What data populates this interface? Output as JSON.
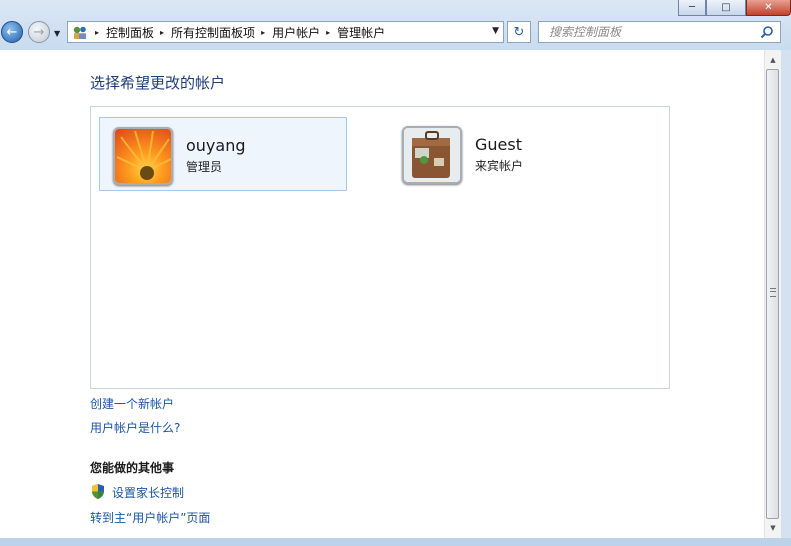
{
  "window": {
    "controls": {
      "minimize": "─",
      "maximize": "□",
      "close": "✕"
    }
  },
  "nav": {
    "back_icon": "←",
    "forward_icon": "→",
    "recent_icon": "▼"
  },
  "address_bar": {
    "icon": "control-panel-folder-icon",
    "breadcrumbs": [
      "控制面板",
      "所有控制面板项",
      "用户帐户",
      "管理帐户"
    ],
    "separator": "▸",
    "dropdown_icon": "▼"
  },
  "refresh_icon": "↻",
  "search": {
    "placeholder": "搜索控制面板"
  },
  "main": {
    "title": "选择希望更改的帐户",
    "accounts": [
      {
        "name": "ouyang",
        "type": "管理员",
        "picture": "orange-flower",
        "selected": true
      },
      {
        "name": "Guest",
        "type": "来宾帐户",
        "picture": "suitcase",
        "selected": false
      }
    ],
    "links": {
      "create_account": "创建一个新帐户",
      "what_is_account": "用户帐户是什么?"
    },
    "other_tasks": {
      "heading": "您能做的其他事",
      "parental_controls": "设置家长控制",
      "goto_main": "转到主“用户帐户”页面"
    }
  },
  "colors": {
    "link": "#1c55a6",
    "title": "#1e3e7a",
    "selected_bg": "#eef5fc",
    "selected_border": "#a9c9ea"
  }
}
